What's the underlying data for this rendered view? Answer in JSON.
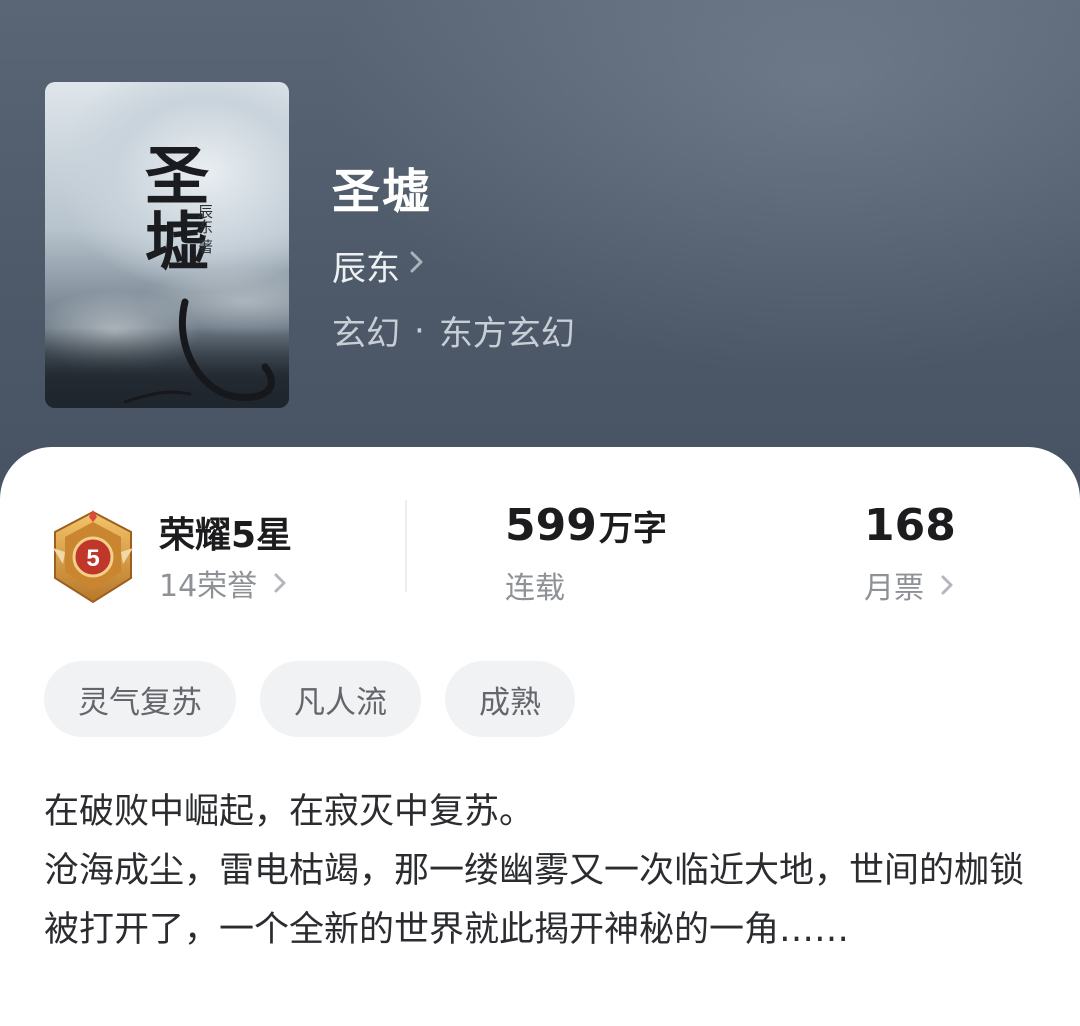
{
  "book": {
    "title": "圣墟",
    "author": "辰东",
    "genre": "玄幻",
    "subgenre": "东方玄幻",
    "genre_separator": "·",
    "cover": {
      "title_text": "圣墟",
      "author_text": "辰东·著"
    }
  },
  "stats": {
    "honor": {
      "title": "荣耀5星",
      "subtitle": "14荣誉",
      "badge_number": "5"
    },
    "words": {
      "number": "599",
      "unit": "万字",
      "status": "连载"
    },
    "votes": {
      "number": "168",
      "label": "月票"
    }
  },
  "tags": [
    "灵气复苏",
    "凡人流",
    "成熟"
  ],
  "description": {
    "line1": "在破败中崛起，在寂灭中复苏。",
    "line2": "沧海成尘，雷电枯竭，那一缕幽雾又一次临近大地，世间的枷锁被打开了，一个全新的世界就此揭开神秘的一角……"
  },
  "colors": {
    "header_bg": "#4e5a69",
    "medal_gold": "#d49a3a",
    "medal_red": "#c0362b",
    "tag_bg": "#f1f2f4"
  },
  "icons": [
    "chevron-right-icon",
    "honor-medal-icon"
  ]
}
